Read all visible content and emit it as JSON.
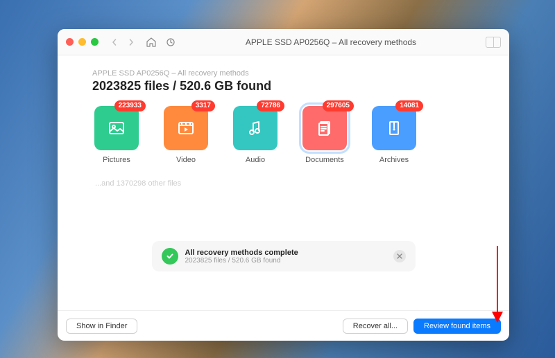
{
  "window": {
    "title": "APPLE SSD AP0256Q – All recovery methods"
  },
  "breadcrumb": "APPLE SSD AP0256Q – All recovery methods",
  "summary": "2023825 files / 520.6 GB found",
  "categories": [
    {
      "name": "Pictures",
      "count": "223933",
      "color": "#2ecc8f",
      "icon": "image",
      "selected": false
    },
    {
      "name": "Video",
      "count": "3317",
      "color": "#ff8a3d",
      "icon": "video",
      "selected": false
    },
    {
      "name": "Audio",
      "count": "72786",
      "color": "#34c6c0",
      "icon": "audio",
      "selected": false
    },
    {
      "name": "Documents",
      "count": "297605",
      "color": "#ff6a6a",
      "icon": "document",
      "selected": true
    },
    {
      "name": "Archives",
      "count": "14081",
      "color": "#4a9eff",
      "icon": "archive",
      "selected": false
    }
  ],
  "other_files": "...and 1370298 other files",
  "status": {
    "title": "All recovery methods complete",
    "subtitle": "2023825 files / 520.6 GB found"
  },
  "footer": {
    "show_in_finder": "Show in Finder",
    "recover_all": "Recover all...",
    "review": "Review found items"
  }
}
